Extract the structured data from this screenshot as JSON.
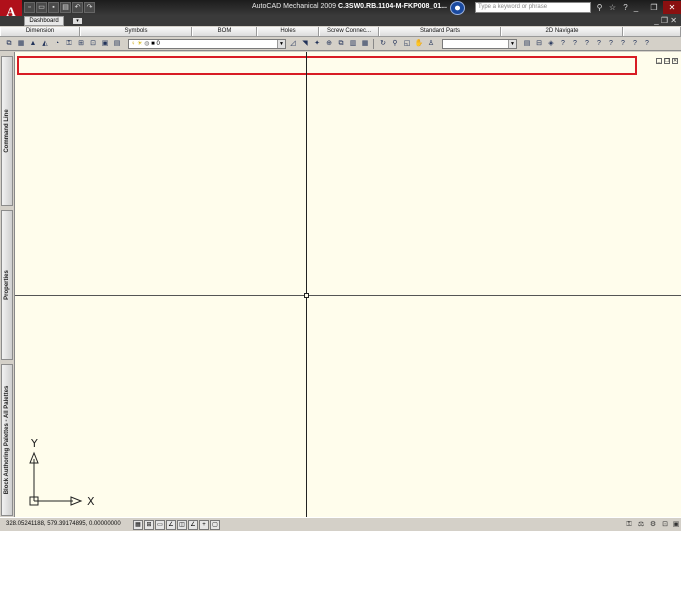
{
  "titlebar": {
    "logo": "A",
    "title_prefix": "AutoCAD Mechanical 2009",
    "title_file": "C.3SW0.RB.1104-M-FKP008_01...",
    "search_placeholder": "Type a keyword or phrase",
    "qat_icons": [
      "new-icon",
      "open-icon",
      "save-icon",
      "print-icon",
      "undo-icon",
      "redo-icon"
    ],
    "right_icons": [
      "binoculars-icon",
      "star-icon",
      "help-icon"
    ],
    "window_controls": [
      "_",
      "❐",
      "✕"
    ]
  },
  "workspace": {
    "tab_label": "Dashboard",
    "tab_dropdown": "▾",
    "right_controls": "_ ❐ ✕"
  },
  "menu_tabs": [
    {
      "label": "Dimension"
    },
    {
      "label": "Symbols"
    },
    {
      "label": "BOM"
    },
    {
      "label": "Holes"
    },
    {
      "label": "Screw Connec..."
    },
    {
      "label": "Standard Parts"
    },
    {
      "label": "2D Navigate"
    }
  ],
  "toolbar": {
    "layer_value": "0",
    "layer_icons": [
      "lightbulb-icon",
      "sun-icon",
      "lock-icon"
    ],
    "style_value": ""
  },
  "palettes": [
    {
      "label": "Command Line"
    },
    {
      "label": "Properties"
    },
    {
      "label": "Block Authoring Palettes - All Palettes"
    }
  ],
  "drawing": {
    "background": "#fffdec",
    "highlight_color": "#d81c24",
    "ucs_x_label": "X",
    "ucs_y_label": "Y",
    "viewport_controls": [
      "_",
      "❐",
      "✕"
    ]
  },
  "statusbar": {
    "coordinates": "328.05241188, 579.39174895, 0.00000000"
  }
}
